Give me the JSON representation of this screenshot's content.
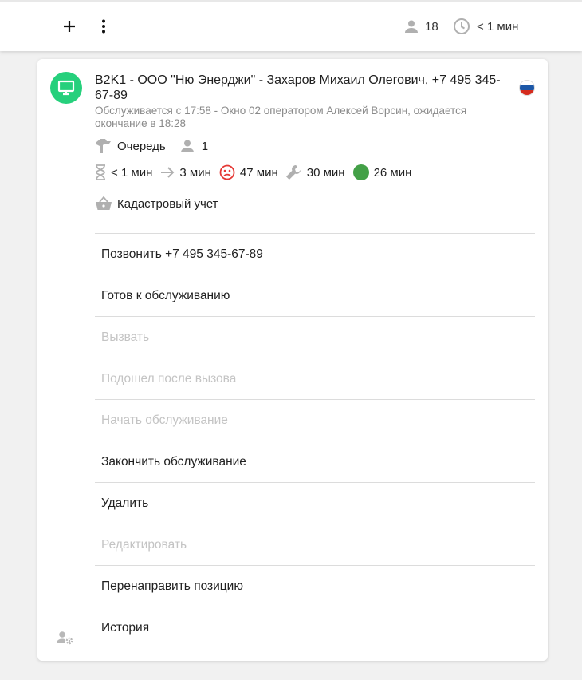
{
  "topbar": {
    "add_icon": "plus-icon",
    "menu_icon": "more-vertical-icon",
    "queue_count": "18",
    "wait_time": "< 1 мин"
  },
  "ticket": {
    "avatar_icon": "monitor-icon",
    "avatar_color": "#26d07c",
    "title": "B2K1 - ООО \"Ню Энерджи\" - Захаров Михаил Олегович, +7 495 345-67-89",
    "subtitle": "Обслуживается с 17:58 - Окно 02 оператором Алексей Ворсин, ожидается окончание в 18:28",
    "flag": "russia-flag",
    "queue_label": "Очередь",
    "queue_people": "1",
    "stats": {
      "wait": "< 1 мин",
      "transfer": "3 мин",
      "overdue": "47 мин",
      "service": "30 мин",
      "total": "26 мин"
    },
    "service_name": "Кадастровый учет"
  },
  "actions": [
    {
      "label": "Позвонить +7 495 345-67-89",
      "enabled": true
    },
    {
      "label": "Готов к обслуживанию",
      "enabled": true
    },
    {
      "label": "Вызвать",
      "enabled": false
    },
    {
      "label": "Подошел после вызова",
      "enabled": false
    },
    {
      "label": "Начать обслуживание",
      "enabled": false
    },
    {
      "label": "Закончить обслуживание",
      "enabled": true
    },
    {
      "label": "Удалить",
      "enabled": true
    },
    {
      "label": "Редактировать",
      "enabled": false
    },
    {
      "label": "Перенаправить позицию",
      "enabled": true
    },
    {
      "label": "История",
      "enabled": true
    }
  ],
  "colors": {
    "accent_green": "#26d07c",
    "status_green": "#43a047",
    "overdue_red": "#e53935",
    "disabled_text": "#c4c4c4"
  }
}
